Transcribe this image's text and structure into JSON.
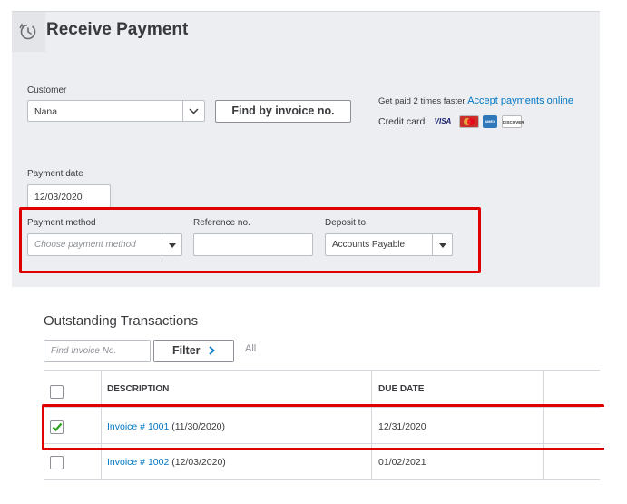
{
  "header": {
    "title": "Receive Payment",
    "icon": "payment-clock-icon"
  },
  "customer": {
    "label": "Customer",
    "value": "Nana",
    "find_button": "Find by invoice no."
  },
  "promo": {
    "text": "Get paid 2 times faster",
    "link": "Accept payments online",
    "credit_card_label": "Credit card",
    "cards": [
      "VISA",
      "MasterCard",
      "AMEX",
      "DISCOVER"
    ]
  },
  "payment_date": {
    "label": "Payment date",
    "value": "12/03/2020"
  },
  "payment_method": {
    "label": "Payment method",
    "placeholder": "Choose payment method"
  },
  "reference": {
    "label": "Reference no.",
    "value": ""
  },
  "deposit": {
    "label": "Deposit to",
    "value": "Accounts Payable"
  },
  "outstanding": {
    "title": "Outstanding Transactions",
    "search_placeholder": "Find Invoice No.",
    "filter_label": "Filter",
    "filter_scope": "All",
    "columns": [
      "DESCRIPTION",
      "DUE DATE"
    ],
    "rows": [
      {
        "checked": true,
        "invoice_link": "Invoice # 1001",
        "invoice_date": "(11/30/2020)",
        "due_date": "12/31/2020"
      },
      {
        "checked": false,
        "invoice_link": "Invoice # 1002",
        "invoice_date": "(12/03/2020)",
        "due_date": "01/02/2021"
      }
    ]
  },
  "colors": {
    "highlight": "#e00000",
    "link": "#0077c5",
    "check": "#2ca01c",
    "panel_bg": "#eceef1"
  }
}
